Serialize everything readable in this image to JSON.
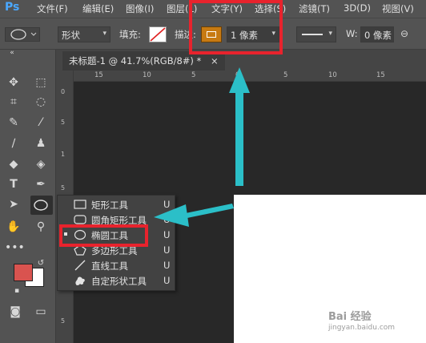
{
  "app": {
    "logo": "Ps"
  },
  "menu": [
    "文件(F)",
    "编辑(E)",
    "图像(I)",
    "图层(L)",
    "文字(Y)",
    "选择(S)",
    "滤镜(T)",
    "3D(D)",
    "视图(V)"
  ],
  "options": {
    "mode_value": "形状",
    "fill_label": "填充:",
    "stroke_label": "描边:",
    "stroke_width_value": "1 像素",
    "width_label": "W:",
    "width_value": "0 像素"
  },
  "document": {
    "tab_title": "未标题-1 @ 41.7%(RGB/8#) *",
    "close_glyph": "×",
    "ruler_top_ticks": [
      "15",
      "10",
      "5",
      "0",
      "5",
      "10",
      "15"
    ],
    "ruler_left_ticks": [
      "0",
      "5",
      "1",
      "5",
      "2",
      "5",
      "3",
      "5"
    ]
  },
  "flyout": {
    "items": [
      {
        "label": "矩形工具",
        "key": "U",
        "icon": "rectangle-icon",
        "selected": false
      },
      {
        "label": "圆角矩形工具",
        "key": "U",
        "icon": "rounded-rectangle-icon",
        "selected": false
      },
      {
        "label": "椭圆工具",
        "key": "U",
        "icon": "ellipse-icon",
        "selected": true
      },
      {
        "label": "多边形工具",
        "key": "U",
        "icon": "polygon-icon",
        "selected": false
      },
      {
        "label": "直线工具",
        "key": "U",
        "icon": "line-icon",
        "selected": false
      },
      {
        "label": "自定形状工具",
        "key": "U",
        "icon": "custom-shape-icon",
        "selected": false
      }
    ]
  },
  "colors": {
    "foreground": "#d9534f",
    "background": "#ffffff",
    "stroke_swatch": "#c77a12",
    "annotation_red": "#e8232d",
    "annotation_cyan": "#2bbfc8"
  },
  "watermark": {
    "text": "Bai 经验",
    "url_text": "jingyan.baidu.com"
  }
}
